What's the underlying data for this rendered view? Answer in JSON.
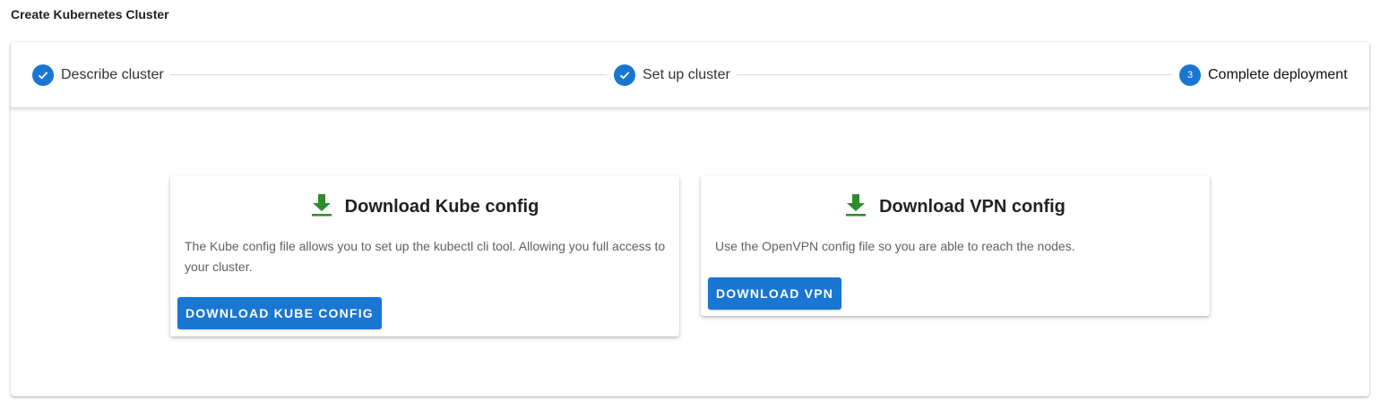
{
  "page": {
    "title": "Create Kubernetes Cluster"
  },
  "stepper": {
    "steps": [
      {
        "label": "Describe cluster",
        "status": "complete",
        "icon": "check-icon"
      },
      {
        "label": "Set up cluster",
        "status": "complete",
        "icon": "check-icon"
      },
      {
        "label": "Complete deployment",
        "status": "active",
        "number": "3"
      }
    ]
  },
  "cards": {
    "kube": {
      "title": "Download Kube config",
      "icon": "download-icon",
      "description": "The Kube config file allows you to set up the kubectl cli tool. Allowing you full access to your cluster.",
      "button_label": "DOWNLOAD KUBE CONFIG"
    },
    "vpn": {
      "title": "Download VPN config",
      "icon": "download-icon",
      "description": "Use the OpenVPN config file so you are able to reach the nodes.",
      "button_label": "DOWNLOAD VPN"
    }
  },
  "colors": {
    "primary": "#1976d2",
    "download_icon": "#2e8b2e"
  }
}
